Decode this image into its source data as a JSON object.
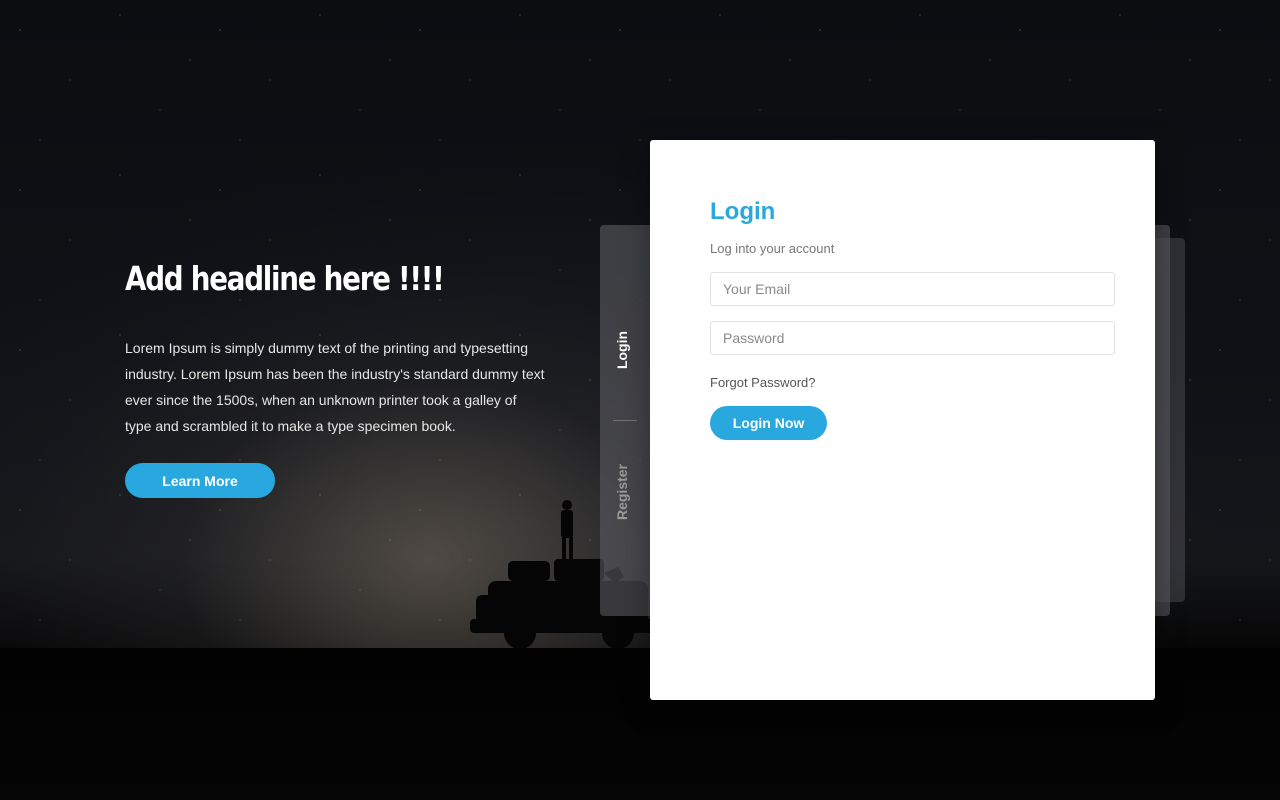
{
  "hero": {
    "headline": "Add headline here !!!!",
    "text": "Lorem Ipsum is simply dummy text of the printing and typesetting industry. Lorem Ipsum has been the industry's standard dummy text ever since the 1500s, when an unknown printer took a galley of type and scrambled it to make a type specimen book.",
    "cta_label": "Learn More"
  },
  "tabs": {
    "login": "Login",
    "register": "Register"
  },
  "login_form": {
    "title": "Login",
    "subtitle": "Log into your account",
    "email_placeholder": "Your Email",
    "password_placeholder": "Password",
    "forgot_label": "Forgot Password?",
    "submit_label": "Login Now"
  },
  "colors": {
    "accent": "#29a8df",
    "card_background": "#ffffff",
    "page_background": "#0b0d11"
  },
  "icons": {
    "background": "night-sky-silhouette"
  }
}
